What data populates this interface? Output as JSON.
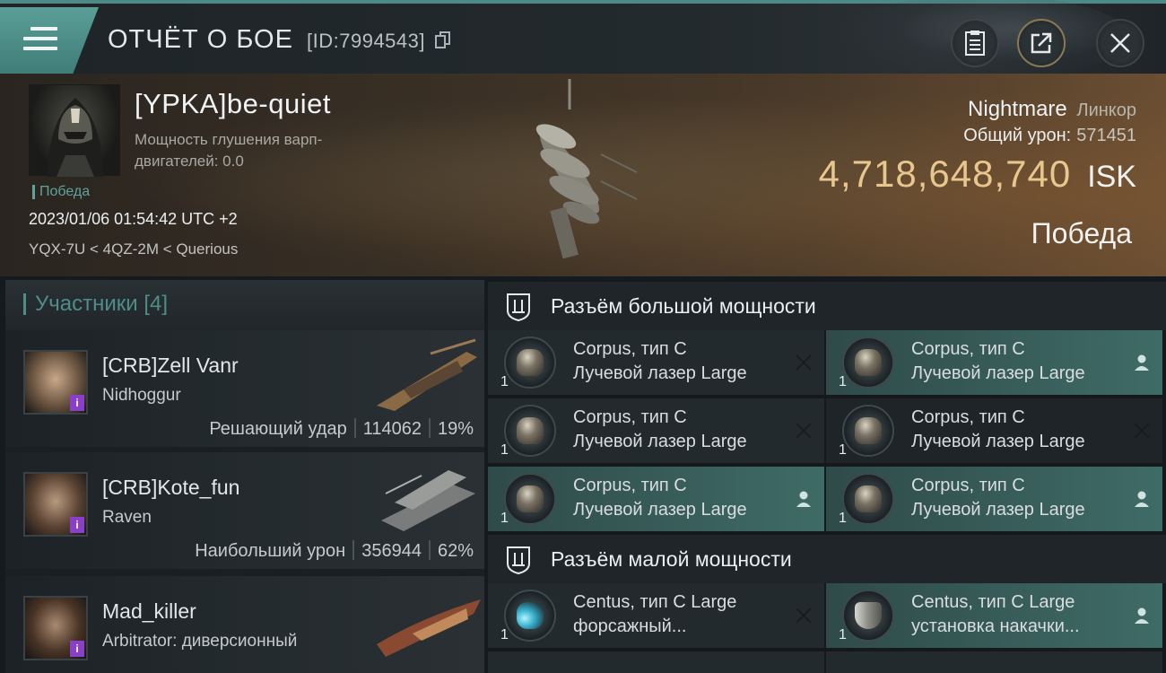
{
  "header": {
    "title": "ОТЧЁТ О БОЕ",
    "report_id": "[ID:7994543]",
    "icons": [
      "menu-icon",
      "copy-icon",
      "clipboard-icon",
      "share-icon",
      "close-icon"
    ]
  },
  "victim": {
    "pilot": "[YPKA]be-quiet",
    "warp_scram_label": "Мощность глушения варп-двигателей: 0.0",
    "status": "Победа",
    "timestamp": "2023/01/06 01:54:42 UTC +2",
    "location": "YQX-7U < 4QZ-2M < Querious",
    "ship": "Nightmare",
    "ship_class": "Линкор",
    "total_damage_label": "Общий урон:",
    "total_damage": "571451",
    "isk_value": "4,718,648,740",
    "isk_currency": "ISK",
    "result": "Победа"
  },
  "participants": {
    "label": "Участники [4]",
    "items": [
      {
        "name": "[CRB]Zell Vanr",
        "ship": "Nidhoggur",
        "role": "Решающий удар",
        "damage": "114062",
        "percent": "19%"
      },
      {
        "name": "[CRB]Kote_fun",
        "ship": "Raven",
        "role": "Наибольший урон",
        "damage": "356944",
        "percent": "62%"
      },
      {
        "name": "Mad_killer",
        "ship": "Arbitrator: диверсионный",
        "role": "",
        "damage": "",
        "percent": ""
      }
    ]
  },
  "high_slots": {
    "title": "Разъём большой мощности",
    "modules": [
      {
        "line1": "Corpus, тип C",
        "line2": "Лучевой лазер Large",
        "qty": "1",
        "state": "destroyed"
      },
      {
        "line1": "Corpus, тип C",
        "line2": "Лучевой лазер Large",
        "qty": "1",
        "state": "dropped"
      },
      {
        "line1": "Corpus, тип C",
        "line2": "Лучевой лазер Large",
        "qty": "1",
        "state": "destroyed"
      },
      {
        "line1": "Corpus, тип C",
        "line2": "Лучевой лазер Large",
        "qty": "1",
        "state": "destroyed"
      },
      {
        "line1": "Corpus, тип C",
        "line2": "Лучевой лазер Large",
        "qty": "1",
        "state": "dropped"
      },
      {
        "line1": "Corpus, тип C",
        "line2": "Лучевой лазер Large",
        "qty": "1",
        "state": "dropped"
      }
    ]
  },
  "low_slots": {
    "title": "Разъём малой мощности",
    "modules": [
      {
        "line1": "Centus, тип C Large",
        "line2": "форсажный...",
        "qty": "1",
        "state": "destroyed"
      },
      {
        "line1": "Centus, тип C Large",
        "line2": "установка накачки...",
        "qty": "1",
        "state": "dropped"
      }
    ]
  },
  "colors": {
    "accent_teal": "#4e8d88",
    "isk_gold": "#e8c78e",
    "fitted_bg": "#3f6b67",
    "corp_badge": "#8a3fc8"
  }
}
